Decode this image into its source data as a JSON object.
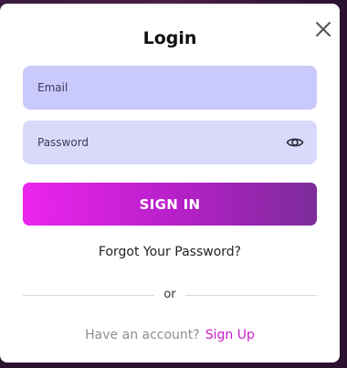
{
  "modal": {
    "title": "Login",
    "close_icon": "close-icon"
  },
  "form": {
    "email_placeholder": "Email",
    "password_placeholder": "Password",
    "password_toggle_icon": "eye-icon",
    "submit_label": "SIGN IN"
  },
  "links": {
    "forgot_password": "Forgot Your Password?",
    "divider_text": "or",
    "account_prompt": "Have an account?",
    "signup": "Sign Up"
  },
  "colors": {
    "accent_start": "#ec24ee",
    "accent_end": "#7b2c9a",
    "signup_link": "#c421c8",
    "email_field_bg": "#c9c9fb",
    "password_field_bg": "#d9d9fc"
  }
}
